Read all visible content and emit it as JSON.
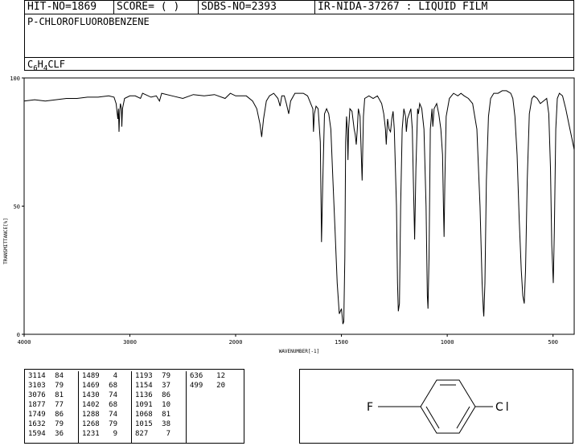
{
  "header": {
    "hit_no": "HIT-NO=1869",
    "score": "SCORE=  (   )",
    "sdbs_no": "SDBS-NO=2393",
    "ir_info": "IR-NIDA-37267 : LIQUID FILM",
    "compound_name": "P-CHLOROFLUOROBENZENE",
    "formula_c": "C",
    "formula_c_sub": "6",
    "formula_h": "H",
    "formula_h_sub": "4",
    "formula_rest": "CLF"
  },
  "chart_data": {
    "type": "line",
    "title": "",
    "xlabel": "WAVENUMBER[-1]",
    "ylabel": "TRANSMITTANCE[%]",
    "xlim": [
      4000,
      400
    ],
    "ylim": [
      0,
      100
    ],
    "x_ticks": [
      "4000",
      "3000",
      "2000",
      "1500",
      "1000",
      "500"
    ],
    "y_ticks": [
      "0",
      "50",
      "100"
    ],
    "grid": false,
    "series": [
      {
        "points": [
          [
            4000,
            91
          ],
          [
            3900,
            91.5
          ],
          [
            3800,
            91
          ],
          [
            3700,
            91.5
          ],
          [
            3600,
            92
          ],
          [
            3500,
            92
          ],
          [
            3400,
            92.5
          ],
          [
            3300,
            92.5
          ],
          [
            3200,
            93
          ],
          [
            3150,
            92.5
          ],
          [
            3130,
            90
          ],
          [
            3114,
            84
          ],
          [
            3108,
            88
          ],
          [
            3103,
            79
          ],
          [
            3096,
            87
          ],
          [
            3090,
            90
          ],
          [
            3080,
            88
          ],
          [
            3076,
            81
          ],
          [
            3070,
            88
          ],
          [
            3050,
            92
          ],
          [
            3000,
            93
          ],
          [
            2950,
            93
          ],
          [
            2900,
            92
          ],
          [
            2880,
            94
          ],
          [
            2800,
            92.5
          ],
          [
            2750,
            93
          ],
          [
            2720,
            91
          ],
          [
            2700,
            94
          ],
          [
            2600,
            93
          ],
          [
            2500,
            92
          ],
          [
            2400,
            93.5
          ],
          [
            2300,
            93
          ],
          [
            2200,
            93.5
          ],
          [
            2100,
            92
          ],
          [
            2050,
            94
          ],
          [
            2000,
            93
          ],
          [
            1950,
            93
          ],
          [
            1920,
            91
          ],
          [
            1900,
            88
          ],
          [
            1885,
            82
          ],
          [
            1877,
            77
          ],
          [
            1868,
            84
          ],
          [
            1855,
            91
          ],
          [
            1840,
            93
          ],
          [
            1820,
            94
          ],
          [
            1800,
            92
          ],
          [
            1790,
            89
          ],
          [
            1782,
            93
          ],
          [
            1770,
            93
          ],
          [
            1760,
            90
          ],
          [
            1749,
            86
          ],
          [
            1740,
            91
          ],
          [
            1720,
            94
          ],
          [
            1700,
            94
          ],
          [
            1680,
            94
          ],
          [
            1660,
            93
          ],
          [
            1645,
            90
          ],
          [
            1635,
            88
          ],
          [
            1632,
            79
          ],
          [
            1628,
            86
          ],
          [
            1620,
            89
          ],
          [
            1610,
            88
          ],
          [
            1600,
            75
          ],
          [
            1594,
            36
          ],
          [
            1588,
            60
          ],
          [
            1580,
            86
          ],
          [
            1570,
            88
          ],
          [
            1560,
            86
          ],
          [
            1550,
            80
          ],
          [
            1540,
            60
          ],
          [
            1530,
            40
          ],
          [
            1520,
            20
          ],
          [
            1510,
            8
          ],
          [
            1500,
            10
          ],
          [
            1493,
            4
          ],
          [
            1489,
            5
          ],
          [
            1484,
            30
          ],
          [
            1480,
            75
          ],
          [
            1476,
            85
          ],
          [
            1472,
            80
          ],
          [
            1469,
            68
          ],
          [
            1466,
            80
          ],
          [
            1460,
            88
          ],
          [
            1450,
            87
          ],
          [
            1440,
            80
          ],
          [
            1435,
            78
          ],
          [
            1430,
            74
          ],
          [
            1425,
            80
          ],
          [
            1420,
            88
          ],
          [
            1412,
            85
          ],
          [
            1402,
            60
          ],
          [
            1396,
            85
          ],
          [
            1390,
            92
          ],
          [
            1370,
            93
          ],
          [
            1350,
            92
          ],
          [
            1330,
            93
          ],
          [
            1310,
            90
          ],
          [
            1300,
            86
          ],
          [
            1292,
            80
          ],
          [
            1288,
            74
          ],
          [
            1282,
            84
          ],
          [
            1275,
            80
          ],
          [
            1268,
            79
          ],
          [
            1262,
            84
          ],
          [
            1256,
            87
          ],
          [
            1250,
            80
          ],
          [
            1240,
            50
          ],
          [
            1235,
            20
          ],
          [
            1231,
            9
          ],
          [
            1226,
            12
          ],
          [
            1220,
            50
          ],
          [
            1213,
            80
          ],
          [
            1205,
            88
          ],
          [
            1197,
            85
          ],
          [
            1193,
            79
          ],
          [
            1188,
            84
          ],
          [
            1180,
            86
          ],
          [
            1172,
            88
          ],
          [
            1165,
            80
          ],
          [
            1160,
            60
          ],
          [
            1154,
            37
          ],
          [
            1148,
            65
          ],
          [
            1140,
            88
          ],
          [
            1136,
            86
          ],
          [
            1130,
            90
          ],
          [
            1120,
            88
          ],
          [
            1110,
            80
          ],
          [
            1100,
            50
          ],
          [
            1094,
            15
          ],
          [
            1091,
            10
          ],
          [
            1086,
            30
          ],
          [
            1080,
            80
          ],
          [
            1072,
            88
          ],
          [
            1068,
            81
          ],
          [
            1062,
            88
          ],
          [
            1050,
            90
          ],
          [
            1040,
            86
          ],
          [
            1030,
            80
          ],
          [
            1022,
            70
          ],
          [
            1018,
            50
          ],
          [
            1015,
            38
          ],
          [
            1011,
            60
          ],
          [
            1005,
            85
          ],
          [
            990,
            92
          ],
          [
            970,
            94
          ],
          [
            950,
            93
          ],
          [
            935,
            94
          ],
          [
            920,
            93
          ],
          [
            900,
            92
          ],
          [
            880,
            90
          ],
          [
            860,
            80
          ],
          [
            845,
            50
          ],
          [
            835,
            20
          ],
          [
            829,
            9
          ],
          [
            827,
            7
          ],
          [
            822,
            20
          ],
          [
            815,
            60
          ],
          [
            805,
            85
          ],
          [
            795,
            92
          ],
          [
            780,
            94
          ],
          [
            760,
            94
          ],
          [
            740,
            95
          ],
          [
            720,
            95
          ],
          [
            700,
            94
          ],
          [
            690,
            92
          ],
          [
            680,
            85
          ],
          [
            670,
            70
          ],
          [
            660,
            45
          ],
          [
            650,
            25
          ],
          [
            643,
            15
          ],
          [
            636,
            12
          ],
          [
            630,
            25
          ],
          [
            622,
            60
          ],
          [
            612,
            86
          ],
          [
            600,
            92
          ],
          [
            590,
            93
          ],
          [
            575,
            92
          ],
          [
            560,
            90
          ],
          [
            545,
            91
          ],
          [
            530,
            92
          ],
          [
            520,
            86
          ],
          [
            512,
            65
          ],
          [
            506,
            35
          ],
          [
            499,
            20
          ],
          [
            494,
            40
          ],
          [
            487,
            80
          ],
          [
            480,
            92
          ],
          [
            470,
            94
          ],
          [
            455,
            93
          ],
          [
            440,
            88
          ],
          [
            425,
            82
          ],
          [
            410,
            76
          ],
          [
            400,
            72
          ]
        ]
      }
    ]
  },
  "peak_table": {
    "columns": [
      [
        [
          "3114",
          "84"
        ],
        [
          "3103",
          "79"
        ],
        [
          "3076",
          "81"
        ],
        [
          "1877",
          "77"
        ],
        [
          "1749",
          "86"
        ],
        [
          "1632",
          "79"
        ],
        [
          "1594",
          "36"
        ]
      ],
      [
        [
          "1489",
          "4"
        ],
        [
          "1469",
          "68"
        ],
        [
          "1430",
          "74"
        ],
        [
          "1402",
          "68"
        ],
        [
          "1288",
          "74"
        ],
        [
          "1268",
          "79"
        ],
        [
          "1231",
          "9"
        ]
      ],
      [
        [
          "1193",
          "79"
        ],
        [
          "1154",
          "37"
        ],
        [
          "1136",
          "86"
        ],
        [
          "1091",
          "10"
        ],
        [
          "1068",
          "81"
        ],
        [
          "1015",
          "38"
        ],
        [
          "827",
          "7"
        ]
      ],
      [
        [
          "636",
          "12"
        ],
        [
          "499",
          "20"
        ]
      ]
    ]
  },
  "structure": {
    "left_atom": "F",
    "right_atom": "Cl"
  }
}
